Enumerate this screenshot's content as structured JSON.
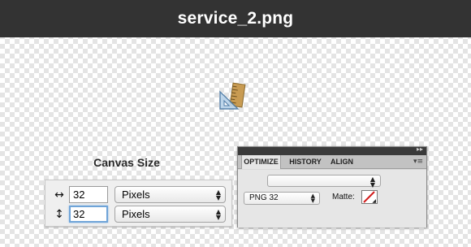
{
  "window": {
    "title": "service_2.png"
  },
  "canvas_size": {
    "title": "Canvas Size",
    "width": {
      "icon": "horizontal-arrows-icon",
      "value": "32",
      "unit": "Pixels"
    },
    "height": {
      "icon": "vertical-arrows-icon",
      "value": "32",
      "unit": "Pixels"
    }
  },
  "optimize_panel": {
    "tabs": [
      {
        "label": "OPTIMIZE",
        "active": true
      },
      {
        "label": "HISTORY",
        "active": false
      },
      {
        "label": "ALIGN",
        "active": false
      }
    ],
    "preset": "",
    "format": "PNG 32",
    "matte_label": "Matte:",
    "matte_color": "none"
  },
  "icons": {
    "file_icon": "ruler-triangle-icon",
    "panel_menu": "panel-menu-icon"
  },
  "colors": {
    "titlebar_bg": "#333333",
    "focus_ring": "#6fa4d8"
  }
}
